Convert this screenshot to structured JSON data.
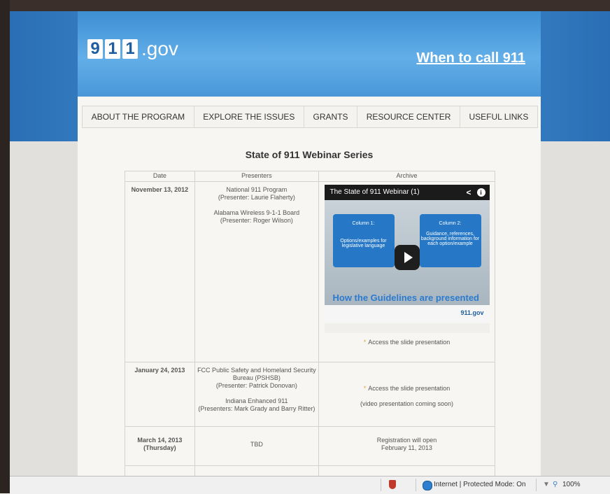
{
  "site": {
    "logo_digits": [
      "9",
      "1",
      "1"
    ],
    "logo_suffix": ".gov",
    "tagline_link": "When to call 911"
  },
  "nav": {
    "items": [
      "ABOUT THE PROGRAM",
      "EXPLORE THE ISSUES",
      "GRANTS",
      "RESOURCE CENTER",
      "USEFUL LINKS"
    ]
  },
  "main": {
    "heading": "State of 911 Webinar Series",
    "table": {
      "headers": [
        "Date",
        "Presenters",
        "Archive"
      ],
      "rows": [
        {
          "date": "November 13, 2012",
          "presenters": [
            "National 911 Program",
            "(Presenter: Laurie Flaherty)",
            "",
            "Alabama Wireless 9-1-1 Board",
            "(Presenter: Roger Wilson)"
          ],
          "video": {
            "title": "The State of 911 Webinar (1)",
            "column1_title": "Column 1:",
            "column1_text": "Options/examples for legislative language",
            "column2_title": "Column 2:",
            "column2_text": "Guidance, references, background information for each option/example",
            "caption": "How the Guidelines are presented",
            "mini_logo": "911.gov"
          },
          "archive_link": "Access the slide presentation"
        },
        {
          "date": "January 24, 2013",
          "presenters": [
            "FCC Public Safety and Homeland Security",
            "Bureau (PSHSB)",
            "(Presenter: Patrick Donovan)",
            "",
            "Indiana Enhanced 911",
            "(Presenters: Mark Grady and Barry Ritter)"
          ],
          "archive_link": "Access the slide presentation",
          "archive_note": "(video presentation coming soon)"
        },
        {
          "date": "March 14, 2013",
          "date_sub": "(Thursday)",
          "presenters": [
            "TBD"
          ],
          "archive_note": "Registration will open",
          "archive_note2": "February 11, 2013"
        }
      ]
    }
  },
  "statusbar": {
    "protected_mode": "Internet | Protected Mode: On",
    "zoom": "100%"
  }
}
